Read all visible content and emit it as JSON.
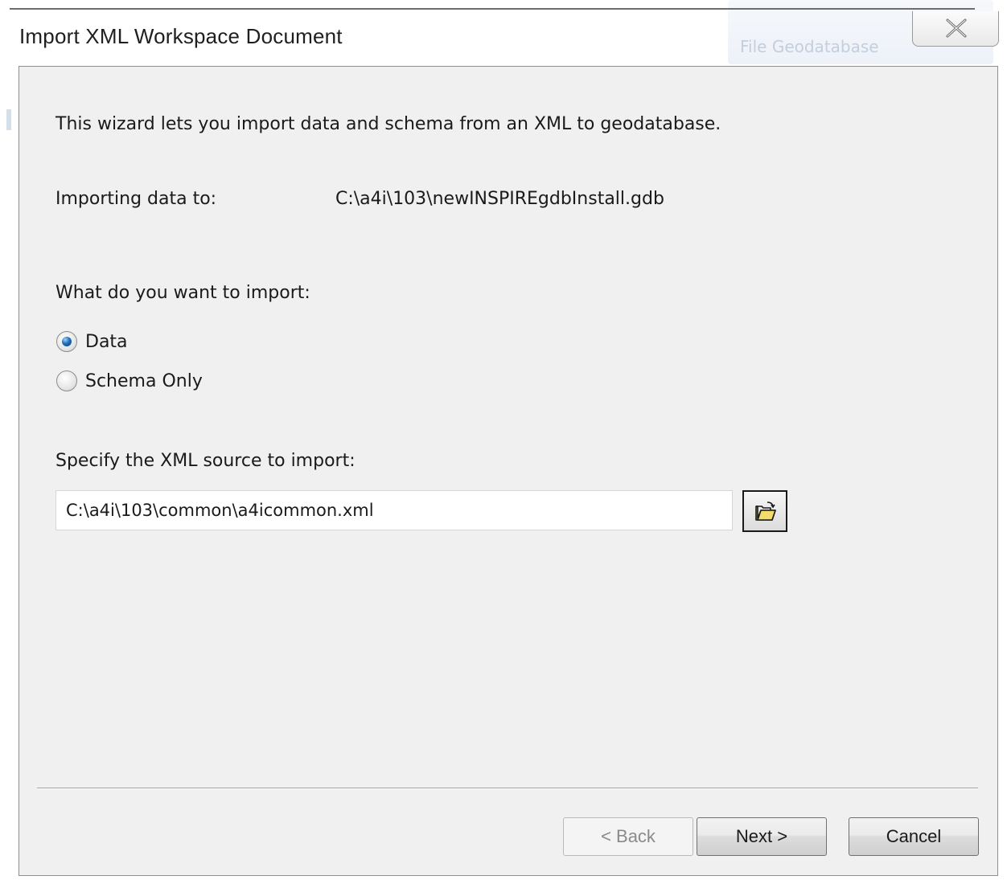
{
  "window": {
    "title": "Import XML Workspace Document"
  },
  "background_app": {
    "partial_text": "File Geodatabase"
  },
  "intro": {
    "text": "This wizard lets you import data and schema from an XML to geodatabase."
  },
  "destination": {
    "label": "Importing data to:",
    "value": "C:\\a4i\\103\\newINSPIREgdbInstall.gdb"
  },
  "import_type": {
    "question": "What do you want to import:",
    "options": [
      {
        "label": "Data",
        "selected": true
      },
      {
        "label": "Schema Only",
        "selected": false
      }
    ]
  },
  "source": {
    "label": "Specify the XML source to import:",
    "value": "C:\\a4i\\103\\common\\a4icommon.xml",
    "browse_icon": "open-folder-icon"
  },
  "footer": {
    "back_label": "< Back",
    "next_label": "Next >",
    "cancel_label": "Cancel"
  },
  "colors": {
    "panel_bg": "#f0f0f0",
    "radio_accent": "#1d6fb8"
  }
}
